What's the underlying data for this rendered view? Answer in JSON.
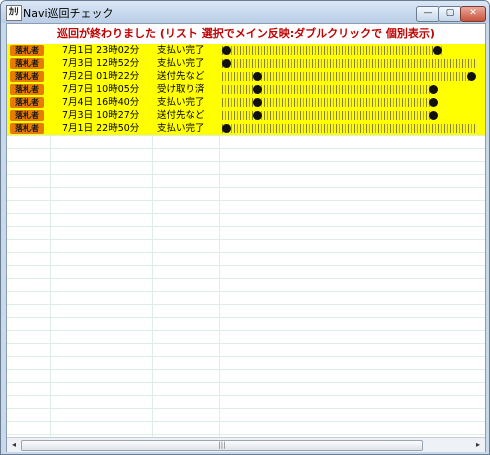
{
  "window": {
    "title": "Navi巡回チェック",
    "app_icon": "ｶﾘ",
    "buttons": {
      "minimize": "—",
      "maximize": "▢",
      "close": "✕"
    }
  },
  "status_message": "巡回が終わりました (リスト 選択でメイン反映:ダブルクリックで 個別表示)",
  "rows": [
    {
      "badge": "落札者",
      "datetime": "7月1日 23時02分",
      "status": "支払い完了"
    },
    {
      "badge": "落札者",
      "datetime": "7月3日 12時52分",
      "status": "支払い完了"
    },
    {
      "badge": "落札者",
      "datetime": "7月2日 01時22分",
      "status": "送付先など"
    },
    {
      "badge": "落札者",
      "datetime": "7月7日 10時05分",
      "status": "受け取り済"
    },
    {
      "badge": "落札者",
      "datetime": "7月4日 16時40分",
      "status": "支払い完了"
    },
    {
      "badge": "落札者",
      "datetime": "7月3日 10時27分",
      "status": "送付先など"
    },
    {
      "badge": "落札者",
      "datetime": "7月1日 22時50分",
      "status": "支払い完了"
    }
  ],
  "scrollbar": {
    "thumb_grip": "|||",
    "left_arrow": "◂",
    "right_arrow": "▸"
  },
  "colors": {
    "row_highlight": "#ffff00",
    "badge": "#e77b00",
    "status_text": "#c00000"
  }
}
